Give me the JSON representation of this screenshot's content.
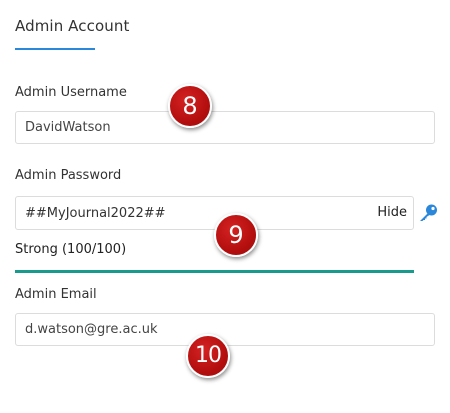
{
  "section": {
    "title": "Admin Account"
  },
  "username": {
    "label": "Admin Username",
    "value": "DavidWatson"
  },
  "password": {
    "label": "Admin Password",
    "value": "##MyJournal2022##",
    "toggle_label": "Hide",
    "generate_icon": "key-icon",
    "strength_text": "Strong (100/100)",
    "strength_score": 100,
    "strength_color": "#1a9a8c"
  },
  "email": {
    "label": "Admin Email",
    "value": "d.watson@gre.ac.uk"
  },
  "markers": [
    "8",
    "9",
    "10"
  ],
  "colors": {
    "accent": "#2b87da",
    "marker": "#b50f0f",
    "key_icon": "#2b87da"
  }
}
